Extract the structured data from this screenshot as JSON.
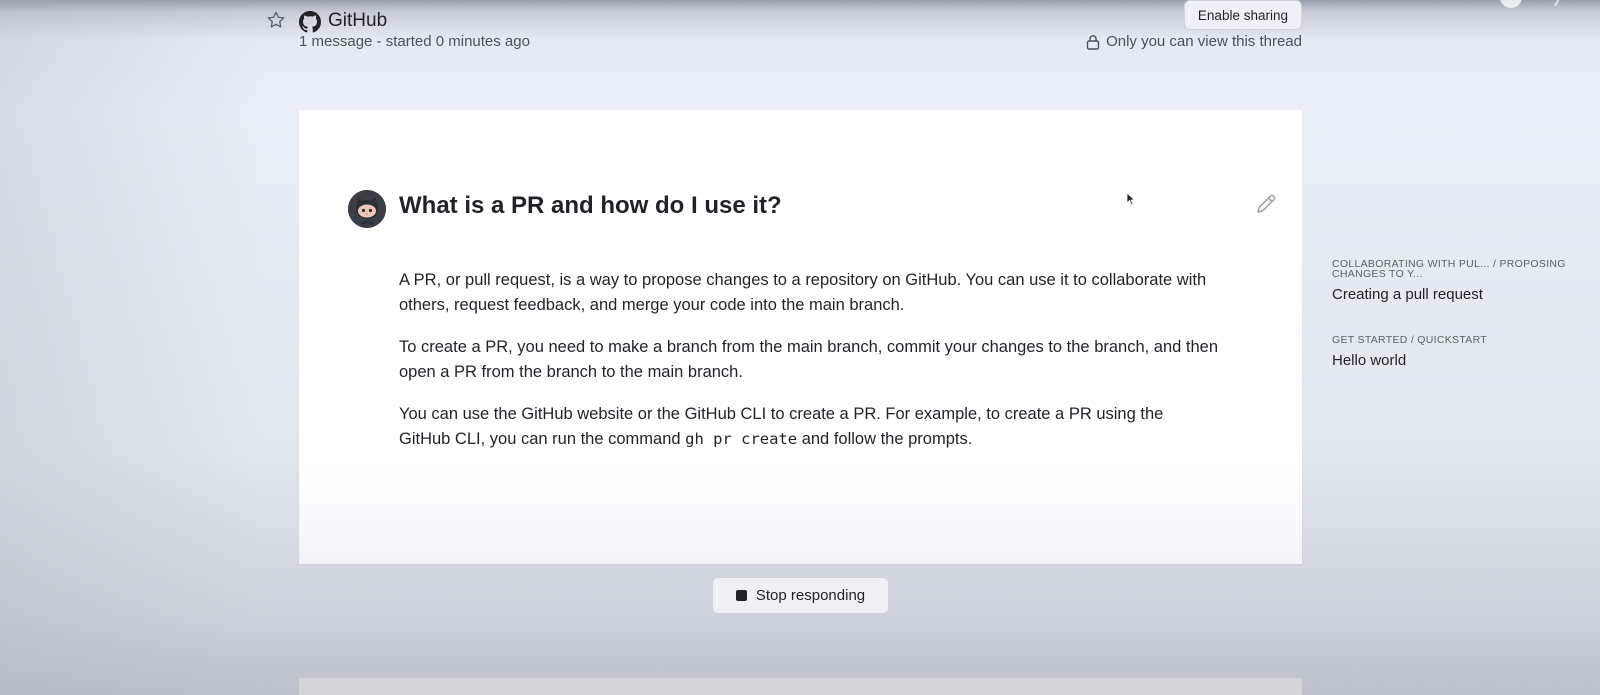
{
  "header": {
    "repo_name": "GitHub",
    "meta": "1 message - started 0 minutes ago",
    "enable_sharing_label": "Enable sharing",
    "privacy_text": "Only you can view this thread"
  },
  "message": {
    "question": "What is a PR and how do I use it?",
    "paragraphs": [
      "A PR, or pull request, is a way to propose changes to a repository on GitHub. You can use it to collaborate with others, request feedback, and merge your code into the main branch.",
      "To create a PR, you need to make a branch from the main branch, commit your changes to the branch, and then open a PR from the branch to the main branch."
    ],
    "paragraph3_before": "You can use the GitHub website or the GitHub CLI to create a PR. For example, to create a PR using the GitHub CLI, you can run the command ",
    "paragraph3_code": "gh pr create",
    "paragraph3_after": " and follow the prompts."
  },
  "stop_button_label": "Stop responding",
  "references": [
    {
      "path": "COLLABORATING WITH PUL... / PROPOSING CHANGES TO Y...",
      "title": "Creating a pull request"
    },
    {
      "path": "GET STARTED / QUICKSTART",
      "title": "Hello world"
    }
  ],
  "icons": {
    "star": "star-icon",
    "logo": "github-logo-icon",
    "lock": "lock-icon",
    "edit": "pencil-icon",
    "stop": "stop-square-icon",
    "avatar": "octocat-avatar"
  }
}
